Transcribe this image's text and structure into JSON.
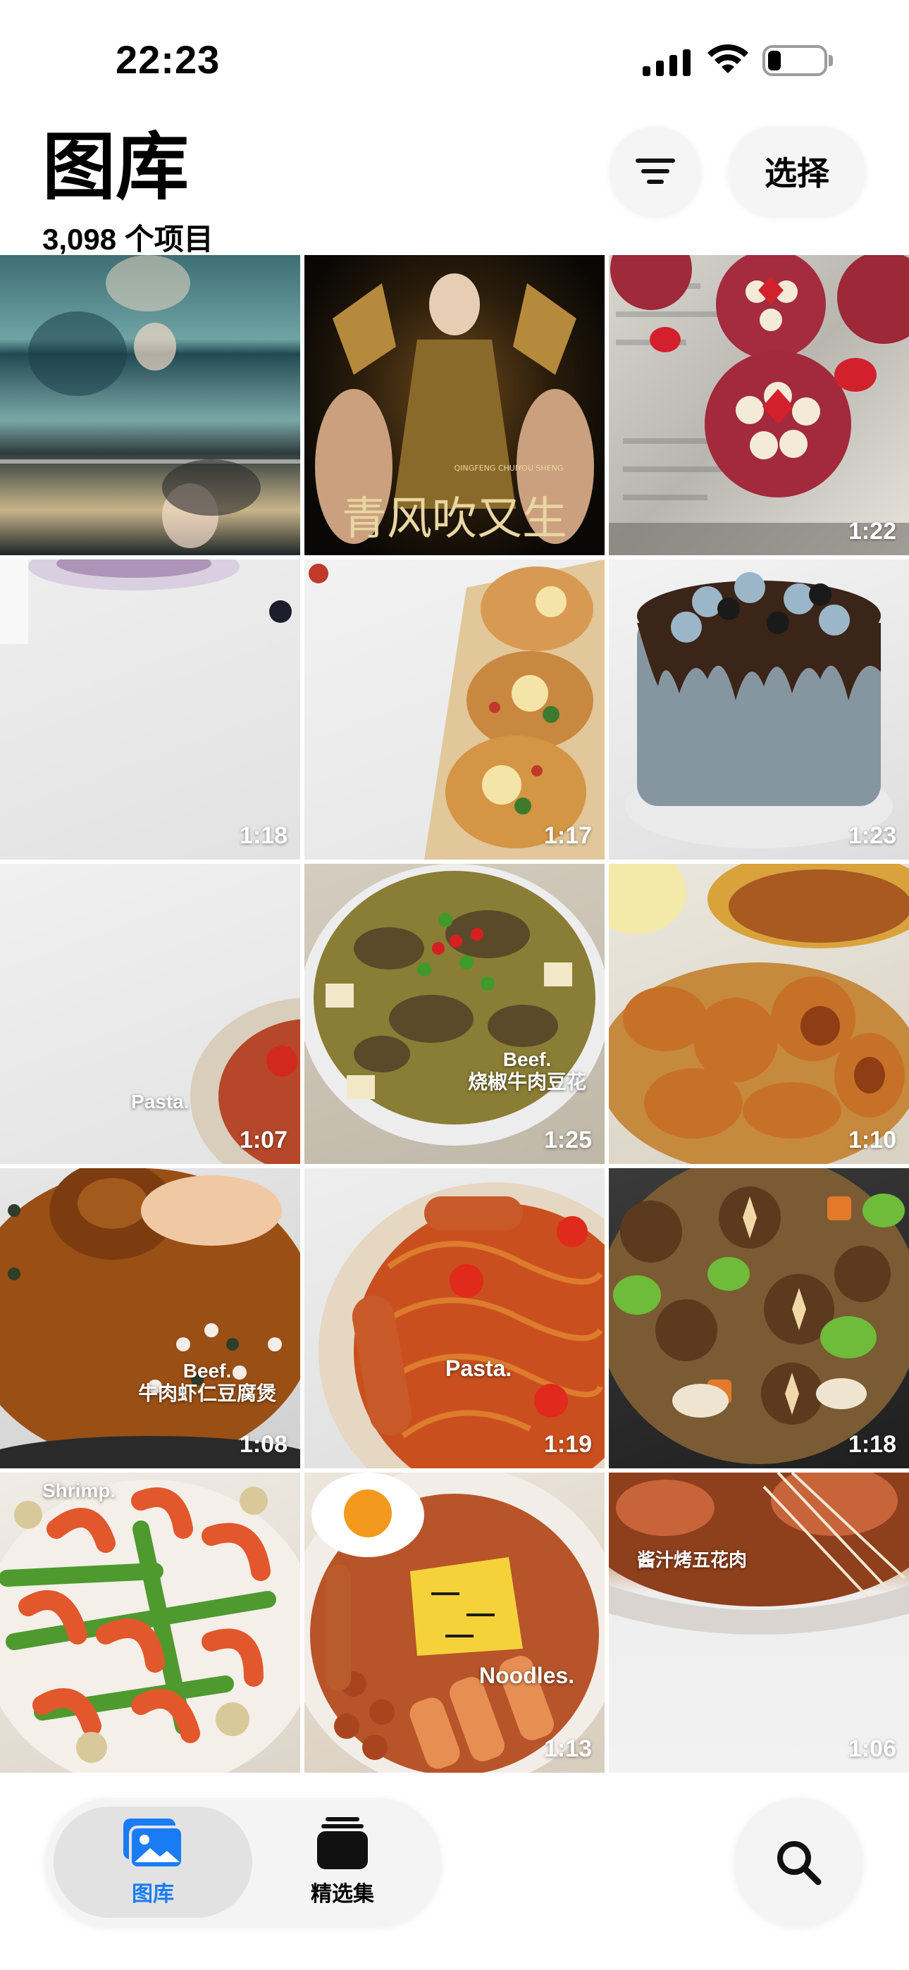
{
  "status_bar": {
    "time": "22:23"
  },
  "header": {
    "title": "图库",
    "item_count": "3,098 个项目",
    "sort_icon": "list-filter-icon",
    "select_label": "选择"
  },
  "grid": {
    "tiles": [
      {
        "duration": "",
        "caption": ""
      },
      {
        "duration": "",
        "caption": "",
        "overlay": "青风吹又生",
        "overlay_small": "QINGFENG CHUIYOU SHENG"
      },
      {
        "duration": "1:22",
        "caption": ""
      },
      {
        "duration": "1:18",
        "caption": ""
      },
      {
        "duration": "1:17",
        "caption": ""
      },
      {
        "duration": "1:23",
        "caption": ""
      },
      {
        "duration": "1:07",
        "caption": "Pasta."
      },
      {
        "duration": "1:25",
        "caption": "Beef.\n烧椒牛肉豆花"
      },
      {
        "duration": "1:10",
        "caption": ""
      },
      {
        "duration": "1:08",
        "caption": "Beef.\n牛肉虾仁豆腐煲"
      },
      {
        "duration": "1:19",
        "caption": "Pasta."
      },
      {
        "duration": "1:18",
        "caption": ""
      },
      {
        "duration": "",
        "caption": "Shrimp."
      },
      {
        "duration": "1:13",
        "caption": "Noodles."
      },
      {
        "duration": "1:06",
        "caption": "酱汁烤五花肉"
      }
    ]
  },
  "tabbar": {
    "library_label": "图库",
    "collections_label": "精选集",
    "library_icon": "photos-icon",
    "collections_icon": "stack-icon",
    "search_icon": "search-icon",
    "active_color": "#1a7cf5"
  }
}
